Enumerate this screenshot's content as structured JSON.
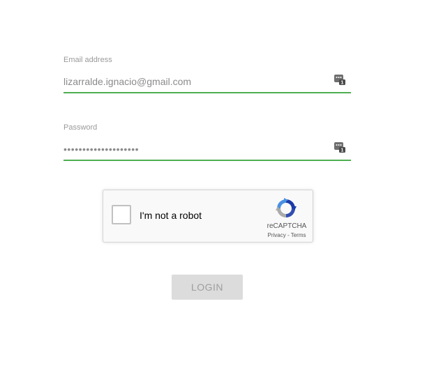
{
  "form": {
    "email": {
      "label": "Email address",
      "value": "lizarralde.ignacio@gmail.com"
    },
    "password": {
      "label": "Password",
      "value": "••••••••••••••••••••"
    },
    "password_manager_icon": "password-manager-icon",
    "accent_color": "#4caf50"
  },
  "recaptcha": {
    "label": "I'm not a robot",
    "brand": "reCAPTCHA",
    "privacy_link": "Privacy",
    "separator": " - ",
    "terms_link": "Terms"
  },
  "login_button": {
    "label": "LOGIN"
  }
}
